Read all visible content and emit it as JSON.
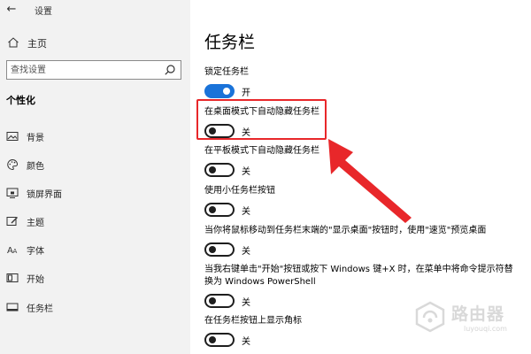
{
  "titlebar": {
    "back_icon": "back-arrow-icon",
    "app_title": "设置"
  },
  "sidebar": {
    "home_label": "主页",
    "search_placeholder": "查找设置",
    "section_title": "个性化",
    "items": [
      {
        "label": "背景",
        "icon": "picture-icon"
      },
      {
        "label": "颜色",
        "icon": "palette-icon"
      },
      {
        "label": "锁屏界面",
        "icon": "lock-screen-icon"
      },
      {
        "label": "主题",
        "icon": "theme-icon"
      },
      {
        "label": "字体",
        "icon": "font-icon"
      },
      {
        "label": "开始",
        "icon": "start-icon"
      },
      {
        "label": "任务栏",
        "icon": "taskbar-icon"
      }
    ]
  },
  "main": {
    "title": "任务栏",
    "settings": [
      {
        "label": "锁定任务栏",
        "state": "开",
        "on": true
      },
      {
        "label": "在桌面模式下自动隐藏任务栏",
        "state": "关",
        "on": false
      },
      {
        "label": "在平板模式下自动隐藏任务栏",
        "state": "关",
        "on": false
      },
      {
        "label": "使用小任务栏按钮",
        "state": "关",
        "on": false
      },
      {
        "label": "当你将鼠标移动到任务栏末端的\"显示桌面\"按钮时，使用\"速览\"预览桌面",
        "state": "关",
        "on": false
      },
      {
        "label": "当我右键单击\"开始\"按钮或按下 Windows 键+X 时，在菜单中将命令提示符替换为 Windows PowerShell",
        "state": "关",
        "on": false
      },
      {
        "label": "在任务栏按钮上显示角标",
        "state": "关",
        "on": false
      }
    ]
  },
  "annotation": {
    "highlight_color": "#e8272a",
    "arrow_color": "#e8272a"
  },
  "watermark": {
    "text": "路由器",
    "url": "luyouqi.com"
  },
  "colors": {
    "accent": "#1a73d9",
    "sidebar_bg": "#f2f2f2"
  }
}
